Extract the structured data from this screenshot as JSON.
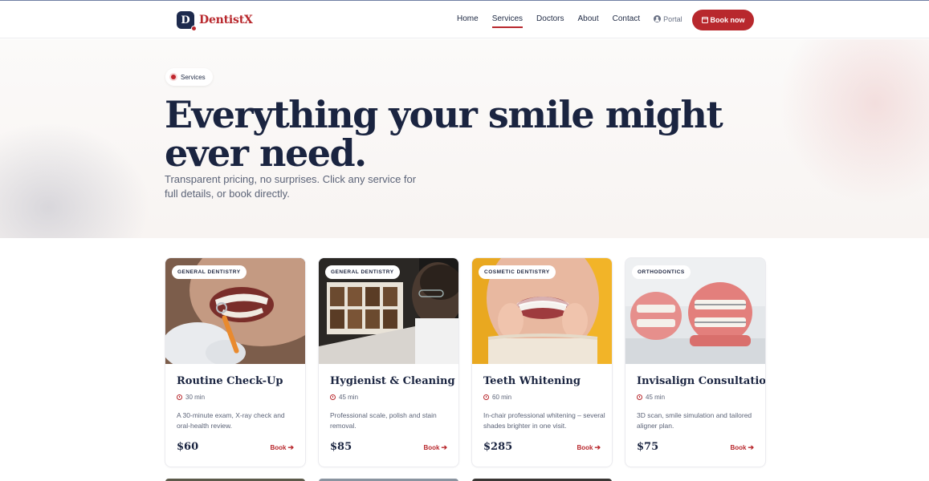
{
  "brand": {
    "logo_letter": "D",
    "name": "DentistX",
    "accent_color": "#b8282d",
    "navy_color": "#1d2a4d"
  },
  "nav": {
    "links": [
      {
        "label": "Home",
        "active": false
      },
      {
        "label": "Services",
        "active": true
      },
      {
        "label": "Doctors",
        "active": false
      },
      {
        "label": "About",
        "active": false
      },
      {
        "label": "Contact",
        "active": false
      }
    ],
    "portal_label": "Portal",
    "portal_icon": "user-circle-icon",
    "book_label": "Book now",
    "book_icon": "calendar-icon"
  },
  "hero": {
    "pill": "Services",
    "title": "Everything your smile might ever need.",
    "subtitle": "Transparent pricing, no surprises. Click any service for full details, or book directly."
  },
  "services": [
    {
      "category": "GENERAL DENTISTRY",
      "title": "Routine Check-Up",
      "duration": "30 min",
      "description": "A 30-minute exam, X-ray check and oral-health review.",
      "price": "$60",
      "cta": "Book"
    },
    {
      "category": "GENERAL DENTISTRY",
      "title": "Hygienist & Cleaning",
      "duration": "45 min",
      "description": "Professional scale, polish and stain removal.",
      "price": "$85",
      "cta": "Book"
    },
    {
      "category": "COSMETIC DENTISTRY",
      "title": "Teeth Whitening",
      "duration": "60 min",
      "description": "In-chair professional whitening – several shades brighter in one visit.",
      "price": "$285",
      "cta": "Book"
    },
    {
      "category": "ORTHODONTICS",
      "title": "Invisalign Consultation",
      "duration": "45 min",
      "description": "3D scan, smile simulation and tailored aligner plan.",
      "price": "$75",
      "cta": "Book"
    }
  ]
}
